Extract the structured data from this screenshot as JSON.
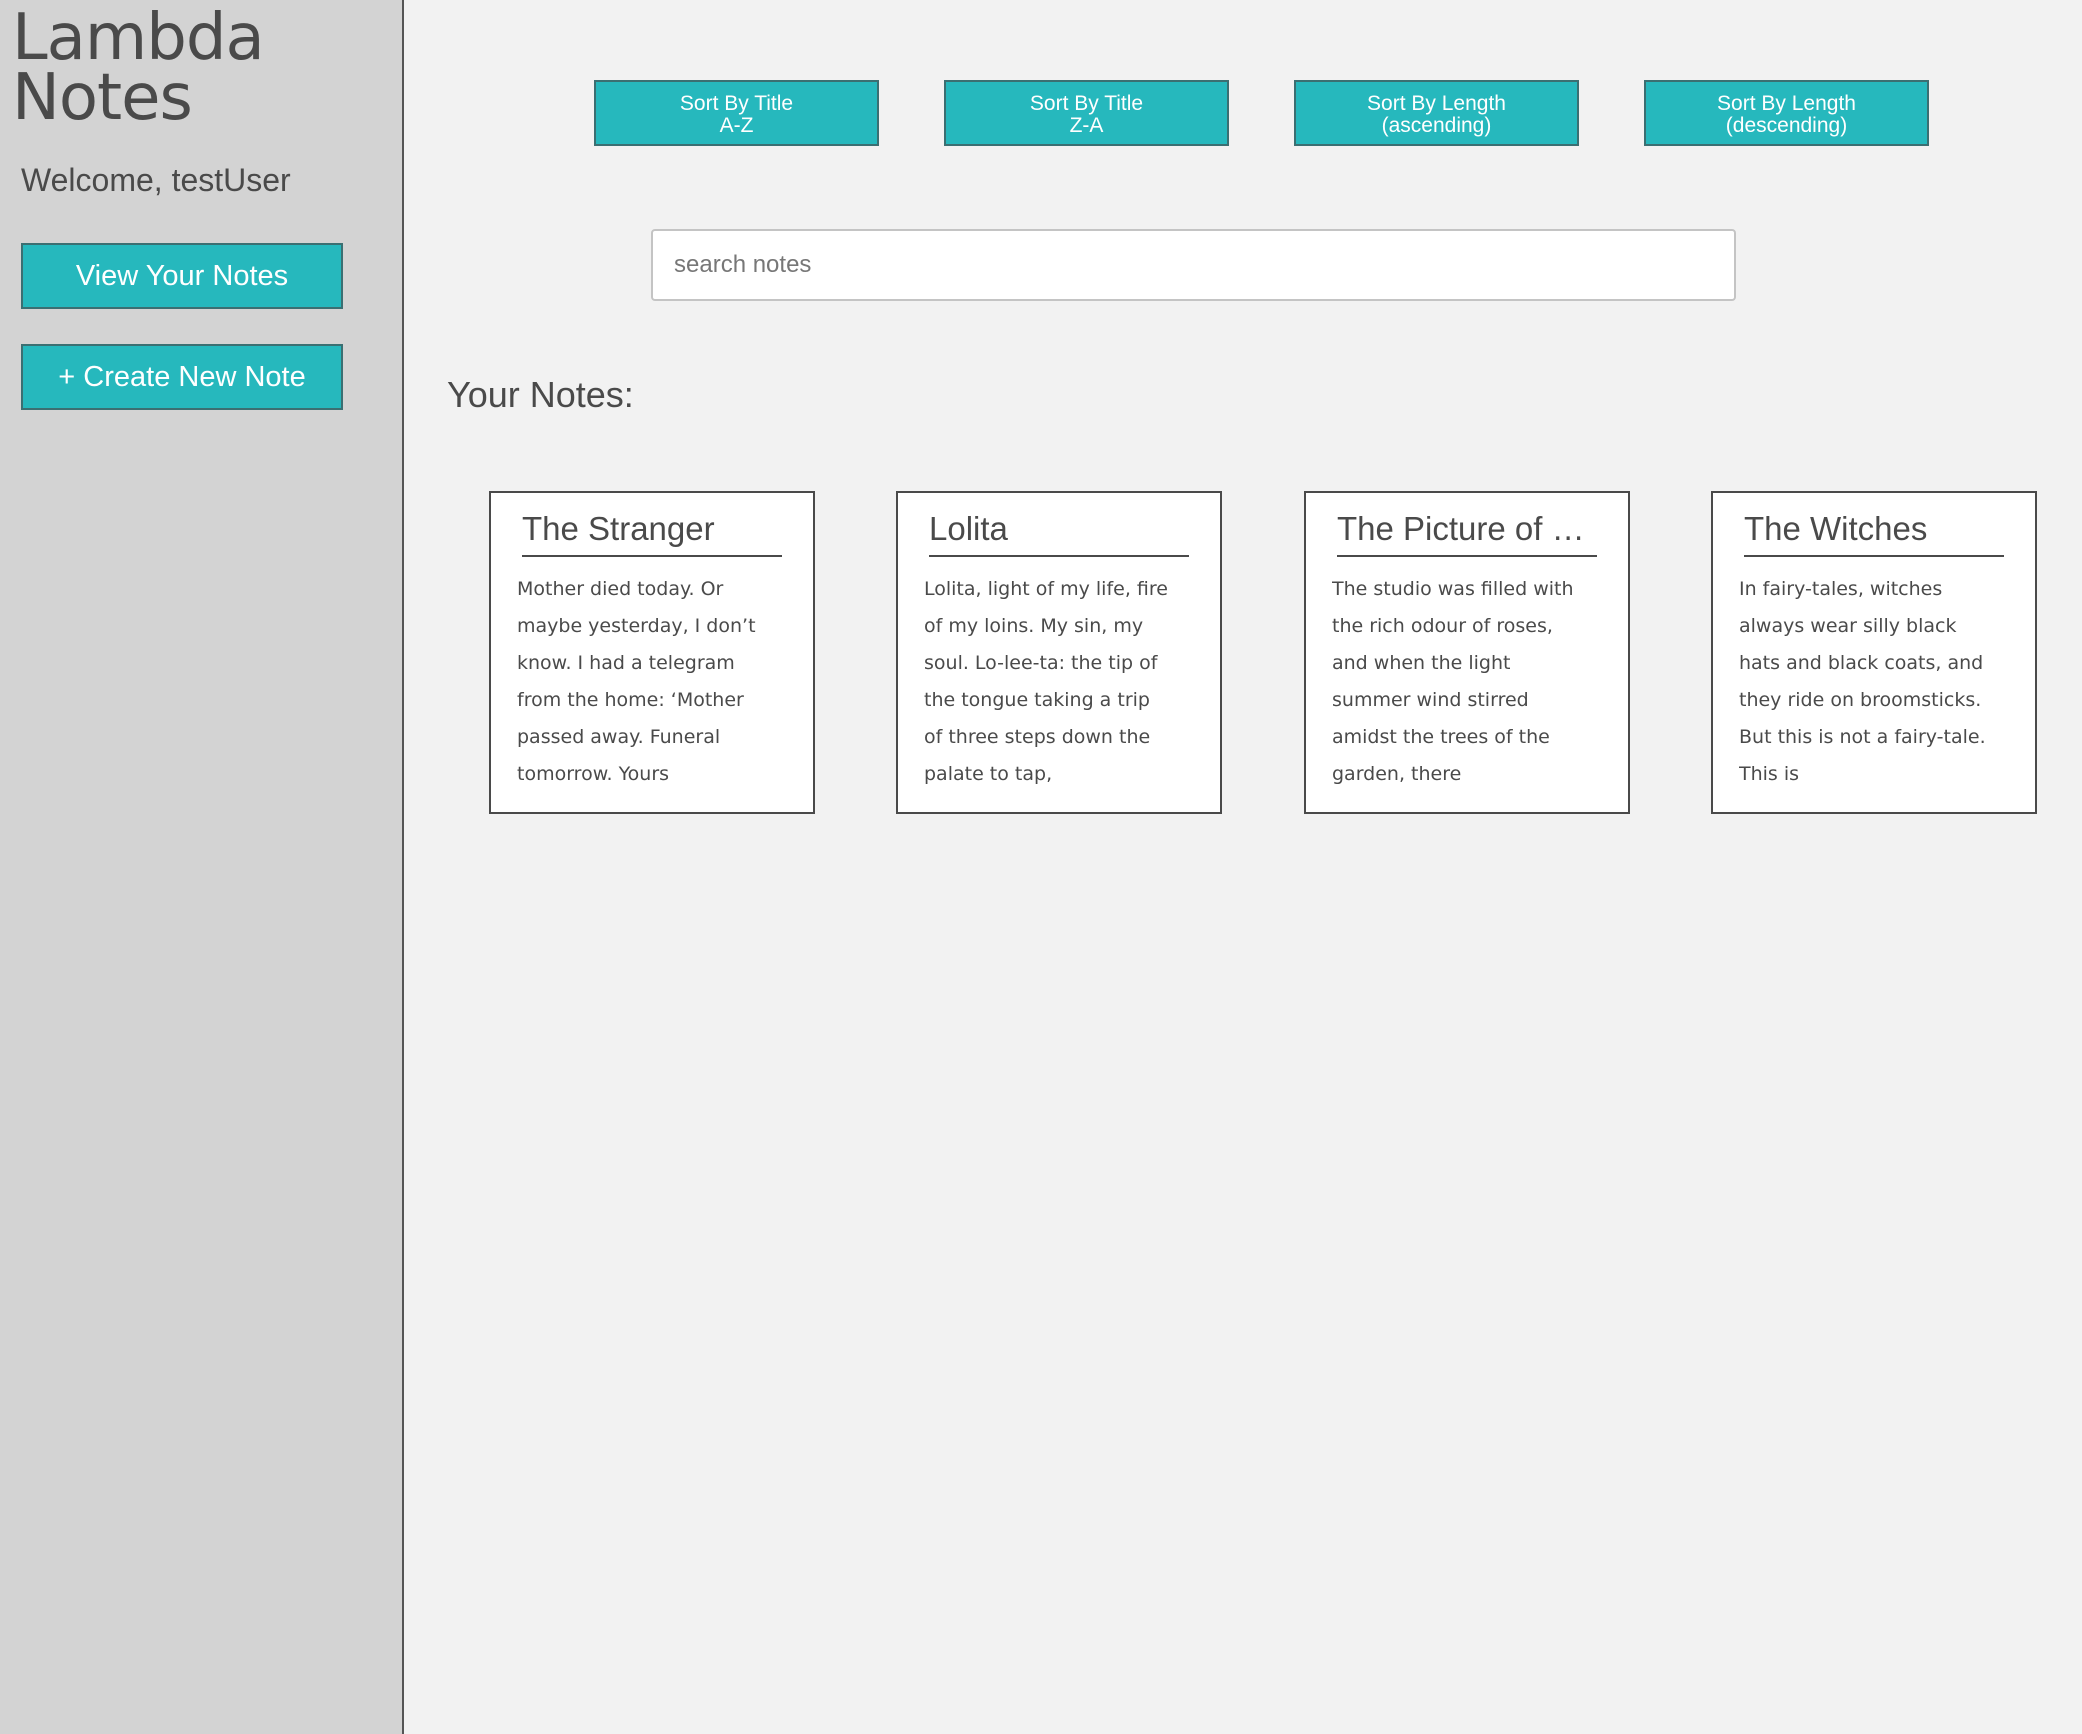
{
  "sidebar": {
    "title_line1": "Lambda",
    "title_line2": "Notes",
    "welcome": "Welcome, testUser",
    "view_notes_label": "View Your Notes",
    "create_note_label": "+ Create New Note"
  },
  "toolbar": {
    "sort_buttons": [
      {
        "line1": "Sort By Title",
        "line2": "A-Z"
      },
      {
        "line1": "Sort By Title",
        "line2": "Z-A"
      },
      {
        "line1": "Sort By Length",
        "line2": "(ascending)"
      },
      {
        "line1": "Sort By Length",
        "line2": "(descending)"
      }
    ]
  },
  "search": {
    "placeholder": "search notes",
    "value": ""
  },
  "main": {
    "heading": "Your Notes:",
    "notes": [
      {
        "title": "The Stranger",
        "excerpt": "Mother died today. Or maybe yesterday, I don’t know. I had a telegram from the home: ‘Mother passed away. Funeral tomorrow. Yours"
      },
      {
        "title": "Lolita",
        "excerpt": "Lolita, light of my life, fire of my loins. My sin, my soul. Lo-lee-ta: the tip of the tongue taking a trip of three steps down the palate to tap,"
      },
      {
        "title": "The Picture of D...",
        "excerpt": "The studio was filled with the rich odour of roses, and when the light summer wind stirred amidst the trees of the garden, there"
      },
      {
        "title": "The Witches",
        "excerpt": "In fairy-tales, witches always wear silly black hats and black coats, and they ride on broomsticks. But this is not a fairy-tale. This is"
      }
    ]
  },
  "colors": {
    "accent": "#26b8bd",
    "sidebar_bg": "#d3d3d3",
    "main_bg": "#f2f2f2",
    "text": "#4a4a4a"
  }
}
